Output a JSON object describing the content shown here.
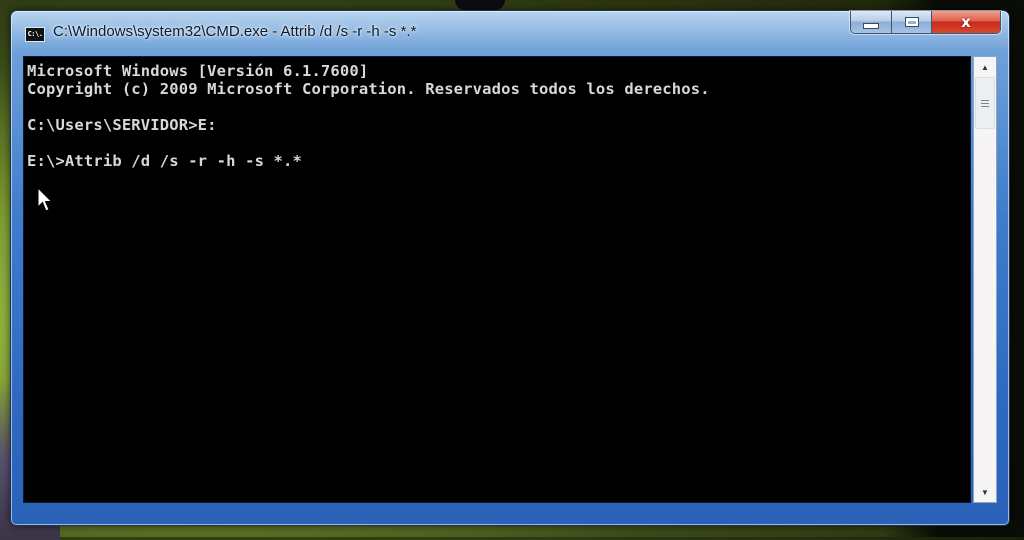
{
  "window": {
    "title": "C:\\Windows\\system32\\CMD.exe - Attrib  /d /s -r -h -s *.*",
    "icon_label": "C:\\.",
    "icon": "cmd-icon",
    "buttons": {
      "minimize": {
        "icon": "minimize-icon",
        "label": "Minimize"
      },
      "maximize": {
        "icon": "maximize-icon",
        "label": "Maximize"
      },
      "close": {
        "icon": "close-icon",
        "label": "x"
      }
    }
  },
  "console": {
    "lines": [
      "Microsoft Windows [Versión 6.1.7600]",
      "Copyright (c) 2009 Microsoft Corporation. Reservados todos los derechos.",
      "",
      "C:\\Users\\SERVIDOR>E:",
      "",
      "E:\\>Attrib /d /s -r -h -s *.*"
    ],
    "colors": {
      "background": "#000000",
      "text": "#d8d8d8"
    }
  },
  "scrollbar": {
    "up_icon": "scroll-up-arrow-icon",
    "down_icon": "scroll-down-arrow-icon",
    "up_glyph": "▲",
    "down_glyph": "▼"
  },
  "accent": {
    "frame": "#3f7ccc",
    "close": "#c8281a"
  }
}
